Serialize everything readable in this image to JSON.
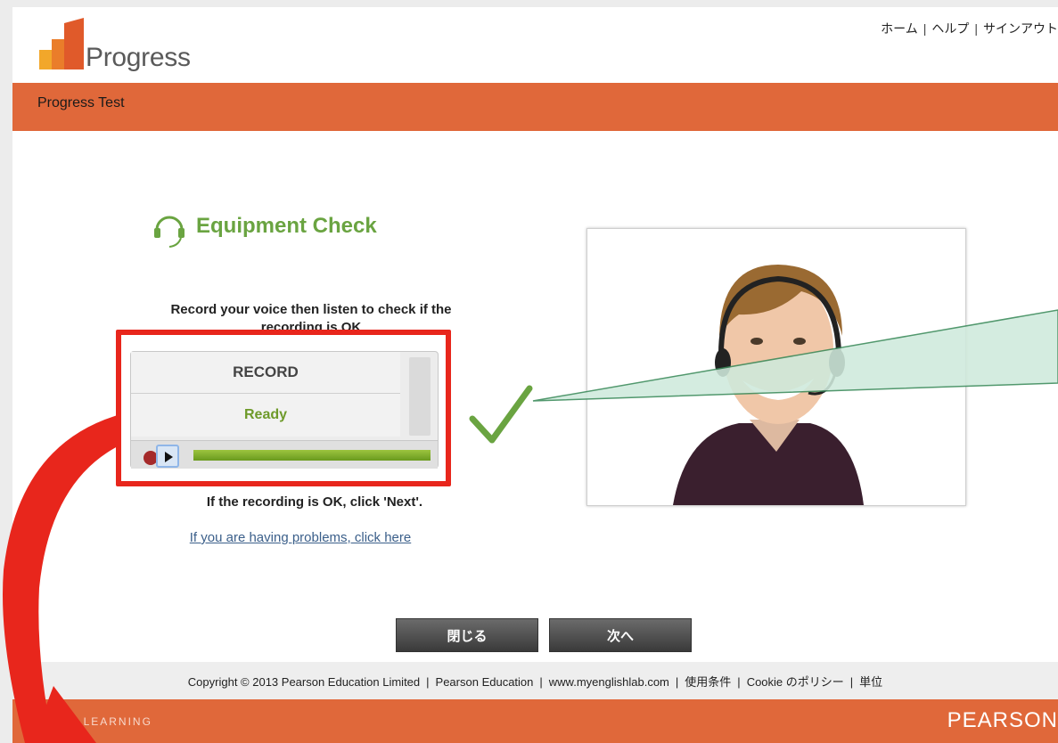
{
  "header": {
    "logo_text": "Progress",
    "links": [
      "ホーム",
      "ヘルプ",
      "サインアウト"
    ],
    "separator": "|"
  },
  "titlebar": {
    "title": "Progress Test"
  },
  "equipment": {
    "title": "Equipment Check",
    "instruction": "Record your voice then listen to check if the recording is OK",
    "recorder": {
      "record_label": "RECORD",
      "status": "Ready",
      "progress_fraction": 1.0
    },
    "ok_note": "If the recording is OK, click 'Next'.",
    "problem_link": "If you are having problems, click here"
  },
  "buttons": {
    "close": "閉じる",
    "next": "次へ"
  },
  "footer": {
    "copyright": "Copyright © 2013 Pearson Education Limited",
    "links": [
      "Pearson Education",
      "www.myenglishlab.com",
      "使用条件",
      "Cookie のポリシー",
      "単位"
    ],
    "separator": "|",
    "always_learning": "ALW YS LEARNING",
    "brand": "PEARSON"
  },
  "colors": {
    "accent_orange": "#e0683a",
    "heading_green": "#6aa441",
    "highlight_red": "#e8261c",
    "callout_green": "#cfeadc"
  }
}
